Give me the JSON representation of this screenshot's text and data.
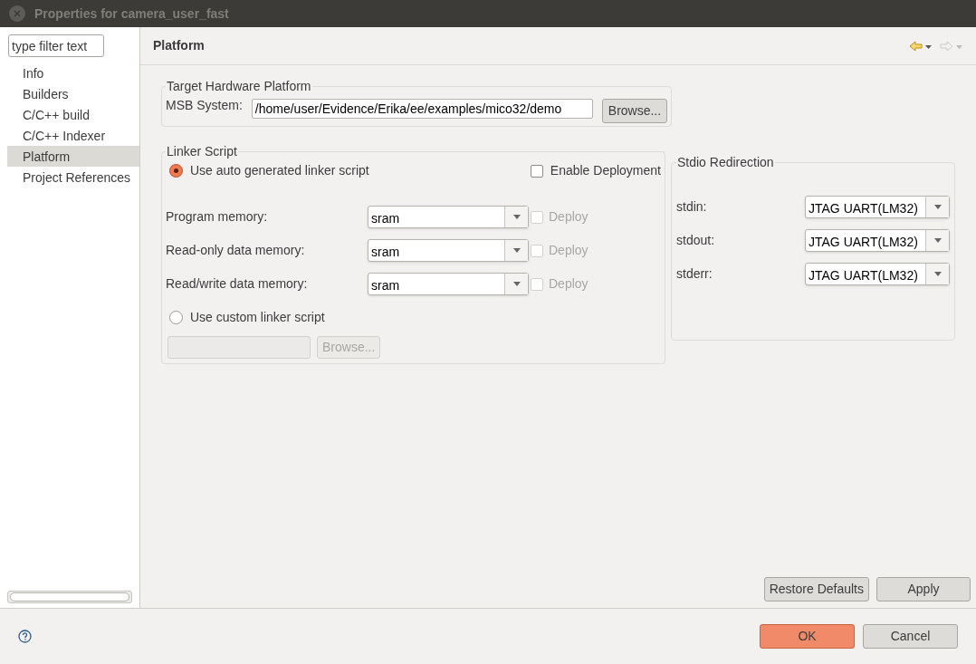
{
  "window": {
    "title": "Properties for camera_user_fast"
  },
  "sidebar": {
    "filter": {
      "placeholder": "type filter text"
    },
    "items": [
      {
        "label": "Info",
        "selected": false
      },
      {
        "label": "Builders",
        "selected": false
      },
      {
        "label": "C/C++ build",
        "selected": false
      },
      {
        "label": "C/C++ Indexer",
        "selected": false
      },
      {
        "label": "Platform",
        "selected": true
      },
      {
        "label": "Project References",
        "selected": false
      }
    ]
  },
  "page": {
    "title": "Platform",
    "target": {
      "title": "Target Hardware Platform",
      "label": "MSB System:",
      "value": "/home/user/Evidence/Erika/ee/examples/mico32/demo",
      "button": "Browse..."
    },
    "linker": {
      "title": "Linker Script",
      "auto": {
        "label": "Use auto generated linker script",
        "selected": true
      },
      "enable_deployment": {
        "label": "Enable Deployment",
        "checked": false
      },
      "memories": [
        {
          "label": "Program memory:",
          "value": "sram",
          "deploy": {
            "label": "Deploy",
            "checked": false,
            "disabled": true
          }
        },
        {
          "label": "Read-only data memory:",
          "value": "sram",
          "deploy": {
            "label": "Deploy",
            "checked": false,
            "disabled": true
          }
        },
        {
          "label": "Read/write data memory:",
          "value": "sram",
          "deploy": {
            "label": "Deploy",
            "checked": false,
            "disabled": true
          }
        }
      ],
      "custom": {
        "label": "Use custom linker script",
        "selected": false
      },
      "browse": {
        "label": "Browse...",
        "disabled": true
      }
    },
    "stdio": {
      "title": "Stdio Redirection",
      "rows": [
        {
          "label": "stdin:",
          "value": "JTAG UART(LM32)"
        },
        {
          "label": "stdout:",
          "value": "JTAG UART(LM32)"
        },
        {
          "label": "stderr:",
          "value": "JTAG UART(LM32)"
        }
      ]
    },
    "buttons": [
      "Restore Defaults",
      "Apply"
    ]
  },
  "footer": {
    "ok": "OK",
    "cancel": "Cancel"
  }
}
